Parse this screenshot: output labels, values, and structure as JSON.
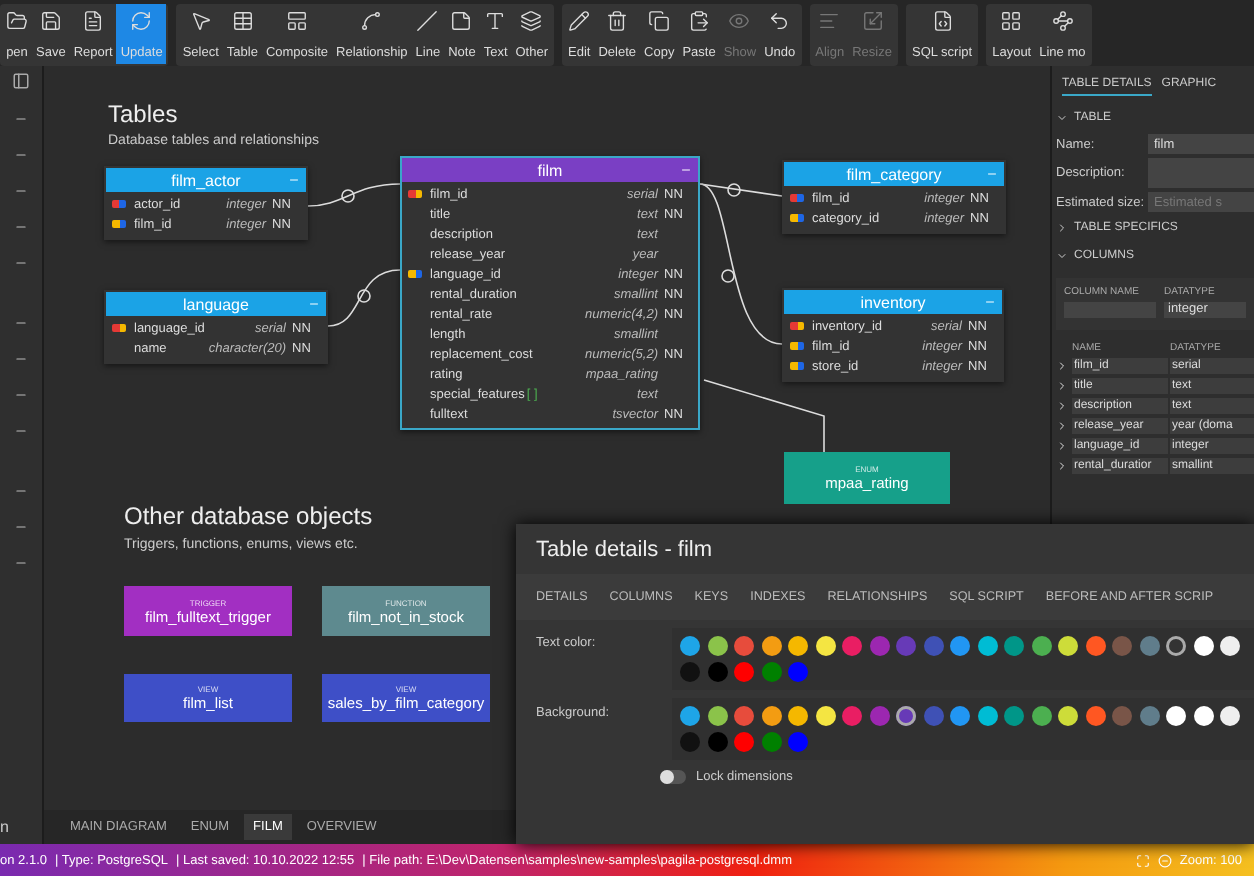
{
  "toolbar": {
    "groups": [
      {
        "items": [
          {
            "label": "pen",
            "selected": false,
            "disabled": false
          },
          {
            "label": "Save",
            "selected": false,
            "disabled": false
          },
          {
            "label": "Report",
            "selected": false,
            "disabled": false
          },
          {
            "label": "Update",
            "selected": true,
            "disabled": false
          }
        ]
      },
      {
        "items": [
          {
            "label": "Select",
            "selected": false,
            "disabled": false
          },
          {
            "label": "Table",
            "selected": false,
            "disabled": false
          },
          {
            "label": "Composite",
            "selected": false,
            "disabled": false
          },
          {
            "label": "Relationship",
            "selected": false,
            "disabled": false
          },
          {
            "label": "Line",
            "selected": false,
            "disabled": false
          },
          {
            "label": "Note",
            "selected": false,
            "disabled": false
          },
          {
            "label": "Text",
            "selected": false,
            "disabled": false
          },
          {
            "label": "Other",
            "selected": false,
            "disabled": false
          }
        ]
      },
      {
        "items": [
          {
            "label": "Edit",
            "selected": false,
            "disabled": false
          },
          {
            "label": "Delete",
            "selected": false,
            "disabled": false
          },
          {
            "label": "Copy",
            "selected": false,
            "disabled": false
          },
          {
            "label": "Paste",
            "selected": false,
            "disabled": false
          },
          {
            "label": "Show",
            "selected": false,
            "disabled": true
          },
          {
            "label": "Undo",
            "selected": false,
            "disabled": false
          }
        ]
      },
      {
        "items": [
          {
            "label": "Align",
            "selected": false,
            "disabled": true
          },
          {
            "label": "Resize",
            "selected": false,
            "disabled": true
          }
        ]
      },
      {
        "items": [
          {
            "label": "SQL script",
            "selected": false,
            "disabled": false
          }
        ]
      },
      {
        "items": [
          {
            "label": "Layout",
            "selected": false,
            "disabled": false
          },
          {
            "label": "Line mo",
            "selected": false,
            "disabled": false
          }
        ]
      }
    ]
  },
  "sidebar": {
    "footer": "n"
  },
  "canvas": {
    "sections": [
      {
        "title": "Tables",
        "subtitle": "Database tables and relationships"
      },
      {
        "title": "Other database objects",
        "subtitle": "Triggers, functions, enums, views etc."
      }
    ],
    "tables": [
      {
        "name": "film_actor",
        "color": "#1ba3e6",
        "selected": false,
        "rows": [
          {
            "name": "actor_id",
            "type": "integer",
            "nn": "NN",
            "kind": "pfk"
          },
          {
            "name": "film_id",
            "type": "integer",
            "nn": "NN",
            "kind": "fk"
          }
        ]
      },
      {
        "name": "language",
        "color": "#1ba3e6",
        "selected": false,
        "rows": [
          {
            "name": "language_id",
            "type": "serial",
            "nn": "NN",
            "kind": "pk"
          },
          {
            "name": "name",
            "type": "character(20)",
            "nn": "NN",
            "kind": "plain"
          }
        ]
      },
      {
        "name": "film",
        "color": "#7a3fc4",
        "selected": true,
        "rows": [
          {
            "name": "film_id",
            "type": "serial",
            "nn": "NN",
            "kind": "pk"
          },
          {
            "name": "title",
            "type": "text",
            "nn": "NN",
            "kind": "plain"
          },
          {
            "name": "description",
            "type": "text",
            "kind": "plain"
          },
          {
            "name": "release_year",
            "type": "year",
            "kind": "plain"
          },
          {
            "name": "language_id",
            "type": "integer",
            "nn": "NN",
            "kind": "fk"
          },
          {
            "name": "rental_duration",
            "type": "smallint",
            "nn": "NN",
            "kind": "plain"
          },
          {
            "name": "rental_rate",
            "type": "numeric(4,2)",
            "nn": "NN",
            "kind": "plain"
          },
          {
            "name": "length",
            "type": "smallint",
            "kind": "plain"
          },
          {
            "name": "replacement_cost",
            "type": "numeric(5,2)",
            "nn": "NN",
            "kind": "plain"
          },
          {
            "name": "rating",
            "type": "mpaa_rating",
            "kind": "plain"
          },
          {
            "name": "special_features",
            "suffix": "[ ]",
            "type": "text",
            "kind": "plain"
          },
          {
            "name": "fulltext",
            "type": "tsvector",
            "nn": "NN",
            "kind": "plain"
          }
        ]
      },
      {
        "name": "film_category",
        "color": "#1ba3e6",
        "selected": false,
        "rows": [
          {
            "name": "film_id",
            "type": "integer",
            "nn": "NN",
            "kind": "pfk"
          },
          {
            "name": "category_id",
            "type": "integer",
            "nn": "NN",
            "kind": "fk"
          }
        ]
      },
      {
        "name": "inventory",
        "color": "#1ba3e6",
        "selected": false,
        "rows": [
          {
            "name": "inventory_id",
            "type": "serial",
            "nn": "NN",
            "kind": "pk"
          },
          {
            "name": "film_id",
            "type": "integer",
            "nn": "NN",
            "kind": "fk"
          },
          {
            "name": "store_id",
            "type": "integer",
            "nn": "NN",
            "kind": "fk"
          }
        ]
      }
    ],
    "objects": [
      {
        "kind": "ENUM",
        "name": "mpaa_rating",
        "color": "#16a08a"
      },
      {
        "kind": "TRIGGER",
        "name": "film_fulltext_trigger",
        "color": "#a22fc2"
      },
      {
        "kind": "FUNCTION",
        "name": "film_not_in_stock",
        "color": "#5e8a8f"
      },
      {
        "kind": "VIEW",
        "name": "film_list",
        "color": "#3e4fc7"
      },
      {
        "kind": "VIEW",
        "name": "sales_by_film_category",
        "color": "#3e4fc7"
      }
    ]
  },
  "diagram_tabs": [
    {
      "label": "MAIN DIAGRAM",
      "selected": false
    },
    {
      "label": "ENUM",
      "selected": false
    },
    {
      "label": "FILM",
      "selected": true
    },
    {
      "label": "OVERVIEW",
      "selected": false
    }
  ],
  "right_panel": {
    "tabs": [
      {
        "label": "TABLE DETAILS",
        "selected": true
      },
      {
        "label": "GRAPHIC",
        "selected": false
      }
    ],
    "table_section": {
      "title": "TABLE",
      "expanded": true,
      "name_label": "Name:",
      "name_value": "film",
      "description_label": "Description:",
      "size_label": "Estimated size:",
      "size_placeholder": "Estimated s"
    },
    "specifics_section": {
      "title": "TABLE SPECIFICS",
      "expanded": false
    },
    "columns_section": {
      "title": "COLUMNS",
      "expanded": true,
      "new_column": {
        "headers": [
          "COLUMN NAME",
          "DATATYPE"
        ],
        "datatype": "integer"
      },
      "headers": [
        "NAME",
        "DATATYPE"
      ],
      "rows": [
        {
          "name": "film_id",
          "type": "serial"
        },
        {
          "name": "title",
          "type": "text"
        },
        {
          "name": "description",
          "type": "text"
        },
        {
          "name": "release_year",
          "type": "year (doma"
        },
        {
          "name": "language_id",
          "type": "integer"
        },
        {
          "name": "rental_duratior",
          "type": "smallint"
        }
      ]
    }
  },
  "dialog": {
    "title": "Table details - film",
    "tabs": [
      {
        "label": "DETAILS",
        "selected": false
      },
      {
        "label": "COLUMNS",
        "selected": false
      },
      {
        "label": "KEYS",
        "selected": false
      },
      {
        "label": "INDEXES",
        "selected": false
      },
      {
        "label": "RELATIONSHIPS",
        "selected": false
      },
      {
        "label": "SQL SCRIPT",
        "selected": false
      },
      {
        "label": "BEFORE AND AFTER SCRIP",
        "selected": false
      }
    ],
    "palettes": [
      {
        "label": "Text color:",
        "rows": [
          [
            {
              "color": "#1ea5e8",
              "selected": false
            },
            {
              "color": "#8bc34a",
              "selected": false
            },
            {
              "color": "#e74c3c",
              "selected": false
            },
            {
              "color": "#f39c12",
              "selected": false
            },
            {
              "color": "#f5b800",
              "selected": false
            },
            {
              "color": "#f4e542",
              "selected": false
            },
            {
              "color": "#e91e63",
              "selected": false
            },
            {
              "color": "#9c27b0",
              "selected": false
            },
            {
              "color": "#673ab7",
              "selected": false
            },
            {
              "color": "#3f51b5",
              "selected": false
            },
            {
              "color": "#2196f3",
              "selected": false
            },
            {
              "color": "#00bcd4",
              "selected": false
            },
            {
              "color": "#009688",
              "selected": false
            },
            {
              "color": "#4caf50",
              "selected": false
            },
            {
              "color": "#cddc39",
              "selected": false
            },
            {
              "color": "#ff5722",
              "selected": false
            },
            {
              "color": "#795548",
              "selected": false
            },
            {
              "color": "#607d8b",
              "selected": false
            },
            {
              "color": "#333333",
              "selected": true
            },
            {
              "color": "#ffffff",
              "selected": false
            },
            {
              "color": "#eeeeee",
              "selected": false
            }
          ],
          [
            {
              "color": "#111111",
              "selected": false
            },
            {
              "color": "#000000",
              "selected": false
            },
            {
              "color": "#ff0000",
              "selected": false
            },
            {
              "color": "#008000",
              "selected": false
            },
            {
              "color": "#0000ff",
              "selected": false
            }
          ]
        ]
      },
      {
        "label": "Background:",
        "rows": [
          [
            {
              "color": "#1ea5e8",
              "selected": false
            },
            {
              "color": "#8bc34a",
              "selected": false
            },
            {
              "color": "#e74c3c",
              "selected": false
            },
            {
              "color": "#f39c12",
              "selected": false
            },
            {
              "color": "#f5b800",
              "selected": false
            },
            {
              "color": "#f4e542",
              "selected": false
            },
            {
              "color": "#e91e63",
              "selected": false
            },
            {
              "color": "#9c27b0",
              "selected": false
            },
            {
              "color": "#673ab7",
              "selected": true
            },
            {
              "color": "#3f51b5",
              "selected": false
            },
            {
              "color": "#2196f3",
              "selected": false
            },
            {
              "color": "#00bcd4",
              "selected": false
            },
            {
              "color": "#009688",
              "selected": false
            },
            {
              "color": "#4caf50",
              "selected": false
            },
            {
              "color": "#cddc39",
              "selected": false
            },
            {
              "color": "#ff5722",
              "selected": false
            },
            {
              "color": "#795548",
              "selected": false
            },
            {
              "color": "#607d8b",
              "selected": false
            },
            {
              "color": "#ffffff",
              "selected": false
            },
            {
              "color": "#ffffff",
              "selected": false
            },
            {
              "color": "#eeeeee",
              "selected": false
            }
          ],
          [
            {
              "color": "#111111",
              "selected": false
            },
            {
              "color": "#000000",
              "selected": false
            },
            {
              "color": "#ff0000",
              "selected": false
            },
            {
              "color": "#008000",
              "selected": false
            },
            {
              "color": "#0000ff",
              "selected": false
            }
          ]
        ]
      }
    ],
    "lock": {
      "label": "Lock dimensions",
      "on": false
    }
  },
  "status_bar": {
    "items": [
      "on 2.1.0",
      "| Type: PostgreSQL",
      "| Last saved: 10.10.2022 12:55",
      "| File path: E:\\Dev\\Datensen\\samples\\new-samples\\pagila-postgresql.dmm"
    ],
    "zoom": "Zoom: 100"
  }
}
